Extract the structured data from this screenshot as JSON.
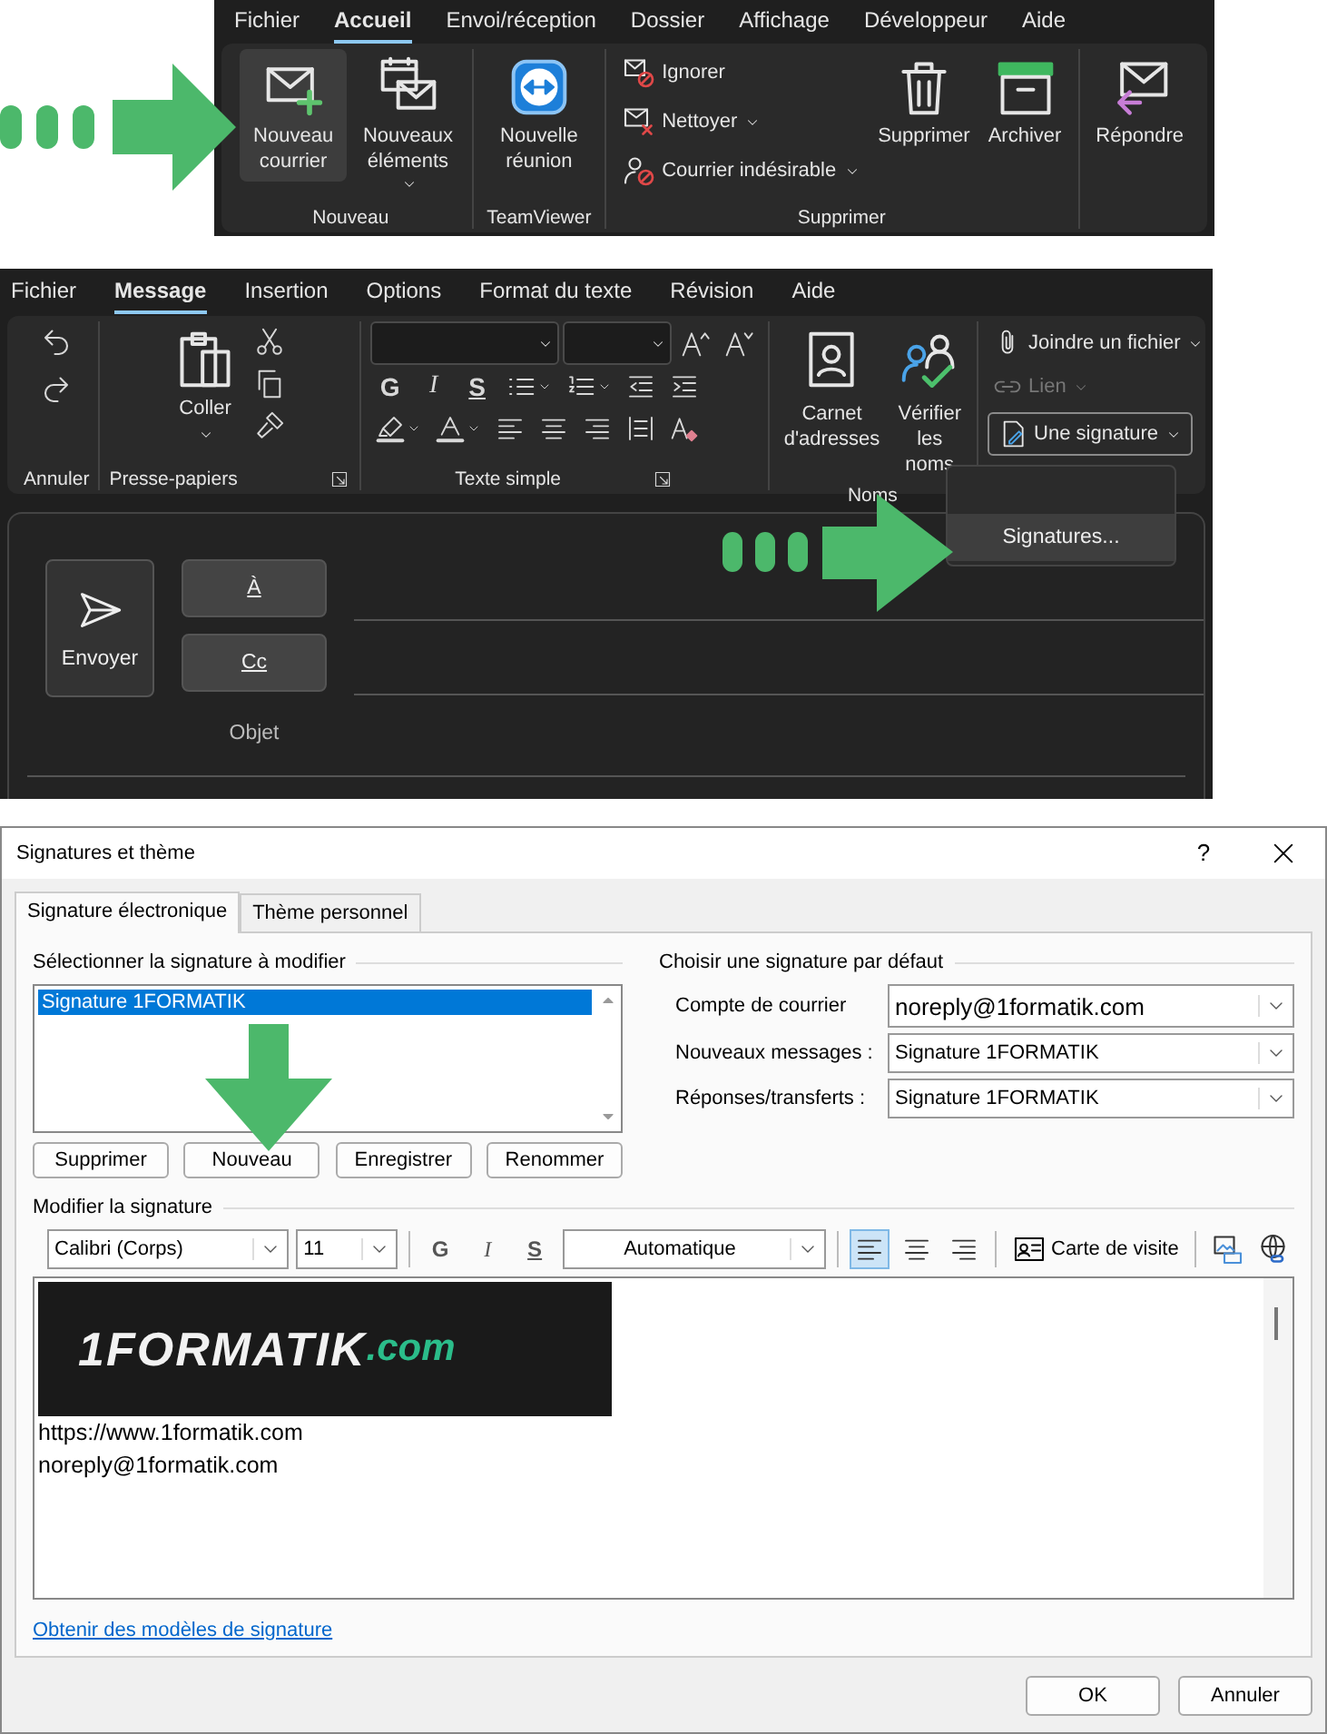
{
  "ribbon_home": {
    "tabs": [
      {
        "label": "Fichier",
        "selected": false
      },
      {
        "label": "Accueil",
        "selected": true
      },
      {
        "label": "Envoi/réception",
        "selected": false
      },
      {
        "label": "Dossier",
        "selected": false
      },
      {
        "label": "Affichage",
        "selected": false
      },
      {
        "label": "Développeur",
        "selected": false
      },
      {
        "label": "Aide",
        "selected": false
      }
    ],
    "groups": [
      {
        "label": "Nouveau",
        "items": [
          {
            "label": "Nouveau courrier",
            "kind": "large",
            "dropdown": false,
            "highlighted": true
          },
          {
            "label": "Nouveaux éléments",
            "kind": "large",
            "dropdown": true,
            "highlighted": false
          }
        ]
      },
      {
        "label": "TeamViewer",
        "items": [
          {
            "label": "Nouvelle réunion",
            "kind": "large",
            "dropdown": false,
            "highlighted": false
          }
        ]
      },
      {
        "label": "Supprimer",
        "items": [
          {
            "label": "Ignorer",
            "kind": "small",
            "dropdown": false,
            "highlighted": false
          },
          {
            "label": "Nettoyer",
            "kind": "small",
            "dropdown": true,
            "highlighted": false
          },
          {
            "label": "Courrier indésirable",
            "kind": "small",
            "dropdown": true,
            "highlighted": false
          },
          {
            "label": "Supprimer",
            "kind": "large",
            "dropdown": false,
            "highlighted": false
          },
          {
            "label": "Archiver",
            "kind": "large",
            "dropdown": false,
            "highlighted": false
          }
        ]
      },
      {
        "items": [
          {
            "label": "Répondre",
            "kind": "large",
            "dropdown": false,
            "highlighted": false
          }
        ]
      }
    ]
  },
  "ribbon_message": {
    "tabs": [
      {
        "label": "Fichier",
        "selected": false
      },
      {
        "label": "Message",
        "selected": true
      },
      {
        "label": "Insertion",
        "selected": false
      },
      {
        "label": "Options",
        "selected": false
      },
      {
        "label": "Format du texte",
        "selected": false
      },
      {
        "label": "Révision",
        "selected": false
      },
      {
        "label": "Aide",
        "selected": false
      }
    ],
    "groups": [
      {
        "label": "Annuler"
      },
      {
        "label": "Presse-papiers",
        "paste": "Coller"
      },
      {
        "label": "Texte simple",
        "format_buttons": [
          "G",
          "I",
          "S"
        ]
      },
      {
        "label": "Noms",
        "buttons": [
          "Carnet d'adresses",
          "Vérifier les noms"
        ]
      },
      {
        "buttons": [
          {
            "label": "Joindre un fichier",
            "disabled": false,
            "highlighted": false
          },
          {
            "label": "Lien",
            "disabled": true,
            "highlighted": false
          },
          {
            "label": "Une signature",
            "disabled": false,
            "highlighted": true
          }
        ]
      }
    ],
    "menu": {
      "items": [
        {
          "label": "Signatures...",
          "selected": true
        }
      ]
    }
  },
  "compose": {
    "send": "Envoyer",
    "to": "À",
    "cc": "Cc",
    "subject_label": "Objet"
  },
  "dialog": {
    "title": "Signatures et thème",
    "help": "?",
    "tabs": [
      {
        "label": "Signature électronique",
        "selected": true
      },
      {
        "label": "Thème personnel",
        "selected": false
      }
    ],
    "select_section": {
      "title": "Sélectionner la signature à modifier",
      "signatures": [
        {
          "name": "Signature 1FORMATIK",
          "selected": true
        }
      ],
      "buttons": [
        "Supprimer",
        "Nouveau",
        "Enregistrer",
        "Renommer"
      ]
    },
    "defaults_section": {
      "title": "Choisir une signature par défaut",
      "fields": [
        {
          "label": "Compte de courrier",
          "value": "noreply@1formatik.com"
        },
        {
          "label": "Nouveaux messages :",
          "value": "Signature 1FORMATIK"
        },
        {
          "label": "Réponses/transferts :",
          "value": "Signature 1FORMATIK"
        }
      ]
    },
    "edit_section": {
      "title": "Modifier la signature",
      "font": "Calibri (Corps)",
      "size": "11",
      "format_buttons": [
        "G",
        "I",
        "S"
      ],
      "color_setting": "Automatique",
      "alignments": [
        {
          "selected": true
        },
        {
          "selected": false
        },
        {
          "selected": false
        }
      ],
      "business_card": "Carte de visite",
      "logo": {
        "name": "1FORMATIK",
        "suffix": ".com"
      },
      "lines": [
        "https://www.1formatik.com",
        "noreply@1formatik.com"
      ]
    },
    "templates_link": "Obtenir des modèles de signature",
    "buttons": [
      "OK",
      "Annuler"
    ]
  }
}
